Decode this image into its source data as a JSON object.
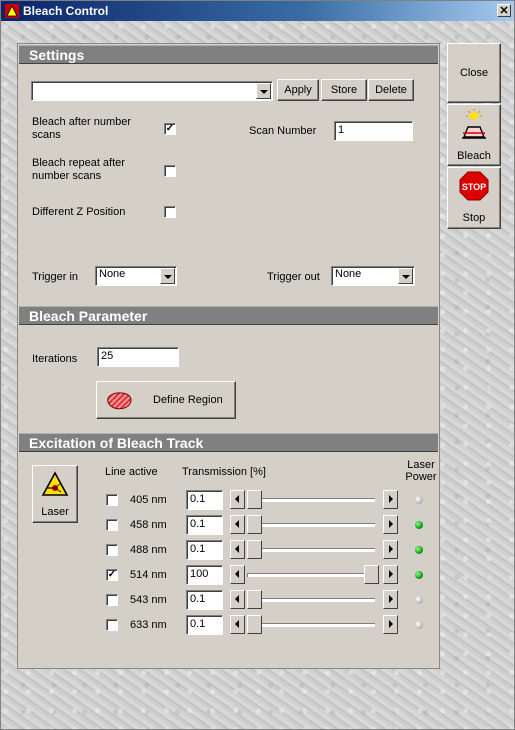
{
  "window": {
    "title": "Bleach Control",
    "close_glyph": "✕"
  },
  "side": {
    "close": "Close",
    "bleach": "Bleach",
    "stop": "Stop",
    "stop_sign": "STOP"
  },
  "settings": {
    "header": "Settings",
    "preset_value": "",
    "apply": "Apply",
    "store": "Store",
    "delete": "Delete",
    "bleach_after_label": "Bleach after number scans",
    "bleach_after_checked": true,
    "scan_number_label": "Scan Number",
    "scan_number_value": "1",
    "bleach_repeat_label": "Bleach repeat after number scans",
    "bleach_repeat_checked": false,
    "diff_z_label": "Different Z Position",
    "diff_z_checked": false,
    "trigger_in_label": "Trigger in",
    "trigger_in_value": "None",
    "trigger_out_label": "Trigger out",
    "trigger_out_value": "None"
  },
  "bleach_parameter": {
    "header": "Bleach Parameter",
    "iterations_label": "Iterations",
    "iterations_value": "25",
    "define_region": "Define Region"
  },
  "excitation": {
    "header": "Excitation of Bleach Track",
    "laser_button": "Laser",
    "col_line_active": "Line active",
    "col_transmission": "Transmission [%]",
    "col_laser": "Laser",
    "col_power": "Power",
    "check_glyph": "✓",
    "lines": [
      {
        "wavelength": "405 nm",
        "active": false,
        "transmission": "0.1",
        "level": 0.001,
        "power_on": false
      },
      {
        "wavelength": "458 nm",
        "active": false,
        "transmission": "0.1",
        "level": 0.001,
        "power_on": true
      },
      {
        "wavelength": "488 nm",
        "active": false,
        "transmission": "0.1",
        "level": 0.001,
        "power_on": true
      },
      {
        "wavelength": "514 nm",
        "active": true,
        "transmission": "100",
        "level": 1.0,
        "power_on": true
      },
      {
        "wavelength": "543 nm",
        "active": false,
        "transmission": "0.1",
        "level": 0.001,
        "power_on": false
      },
      {
        "wavelength": "633 nm",
        "active": false,
        "transmission": "0.1",
        "level": 0.001,
        "power_on": false
      }
    ]
  }
}
